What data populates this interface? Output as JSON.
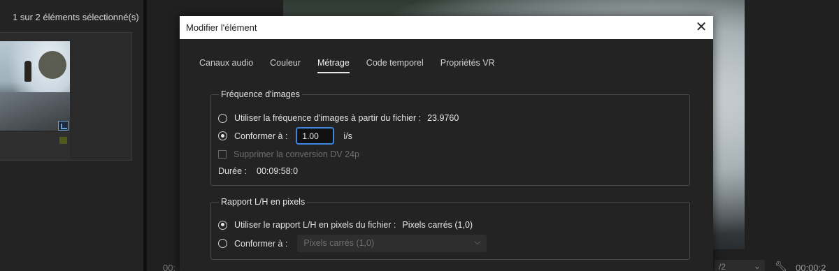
{
  "project_panel": {
    "selection_count": "1 sur 2 éléments sélectionné(s)"
  },
  "monitor": {
    "timecode_left": "00:",
    "zoom_select": "/2",
    "timecode_right": "00:00:2"
  },
  "dialog": {
    "title": "Modifier l'élément",
    "tabs": [
      {
        "label": "Canaux audio",
        "active": false
      },
      {
        "label": "Couleur",
        "active": false
      },
      {
        "label": "Métrage",
        "active": true
      },
      {
        "label": "Code temporel",
        "active": false
      },
      {
        "label": "Propriétés VR",
        "active": false
      }
    ],
    "frame_rate": {
      "legend": "Fréquence d'images",
      "use_file_label": "Utiliser la fréquence d'images à partir du fichier :",
      "file_value": "23.9760",
      "conform_label": "Conformer à :",
      "conform_value": "1.00",
      "conform_unit": "i/s",
      "remove_pulldown_label": "Supprimer la conversion DV 24p",
      "duration_label": "Durée :",
      "duration_value": "00:09:58:0"
    },
    "pixel_aspect": {
      "legend": "Rapport L/H en pixels",
      "use_file_label": "Utiliser le rapport L/H en pixels du fichier :",
      "file_value": "Pixels carrés (1,0)",
      "conform_label": "Conformer à :",
      "conform_select_value": "Pixels carrés (1,0)"
    }
  }
}
